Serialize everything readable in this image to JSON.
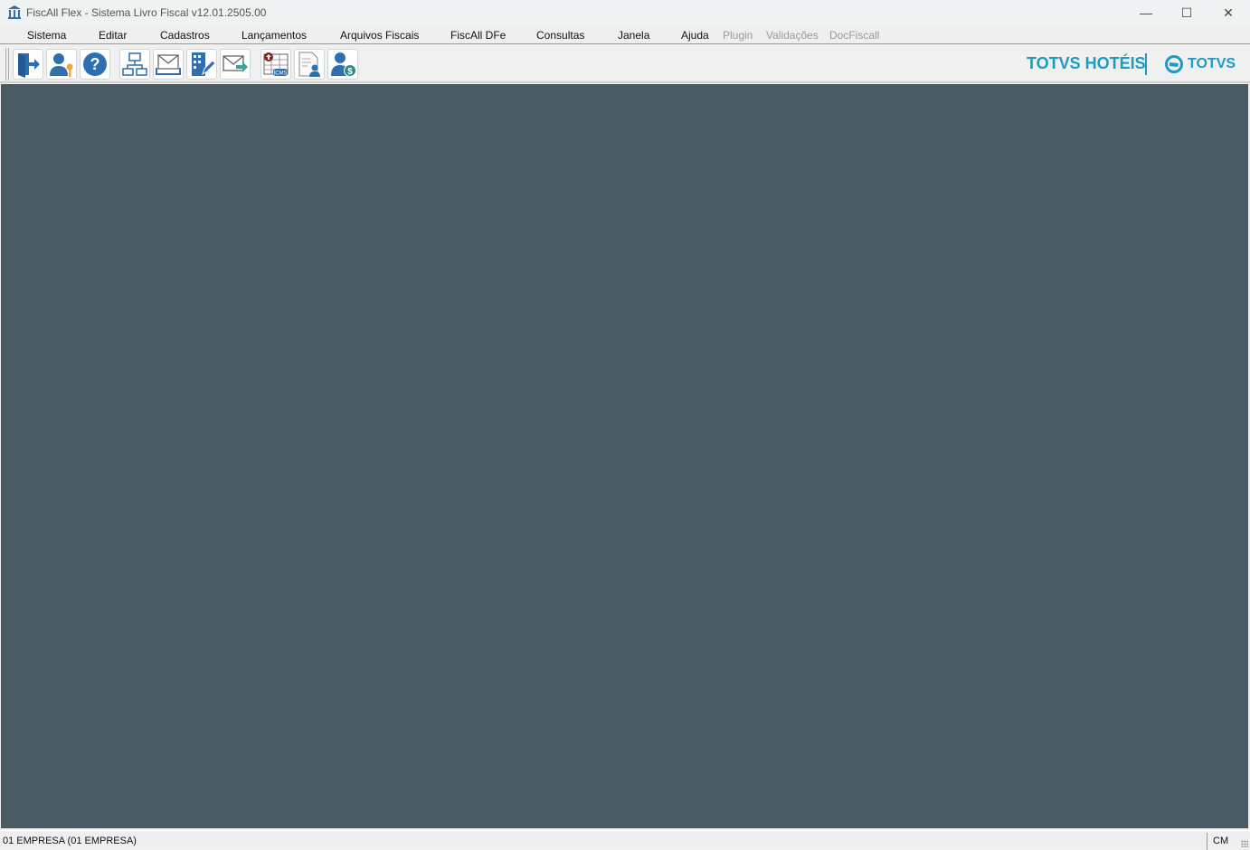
{
  "window": {
    "title": "FiscAll Flex - Sistema Livro Fiscal v12.01.2505.00",
    "minimize": "—",
    "maximize": "☐",
    "close": "✕"
  },
  "menu": [
    {
      "label": "Sistema",
      "enabled": true
    },
    {
      "label": "Editar",
      "enabled": true
    },
    {
      "label": "Cadastros",
      "enabled": true
    },
    {
      "label": "Lançamentos",
      "enabled": true
    },
    {
      "label": "Arquivos Fiscais",
      "enabled": true
    },
    {
      "label": "FiscAll DFe",
      "enabled": true
    },
    {
      "label": "Consultas",
      "enabled": true
    },
    {
      "label": "Janela",
      "enabled": true
    },
    {
      "label": "Ajuda",
      "enabled": true
    },
    {
      "label": "Plugin",
      "enabled": false
    },
    {
      "label": "Validações",
      "enabled": false
    },
    {
      "label": "DocFiscall",
      "enabled": false
    }
  ],
  "toolbar": {
    "buttons": [
      "exit-icon",
      "user-key-icon",
      "help-icon",
      "org-chart-icon",
      "mail-inbox-icon",
      "building-edit-icon",
      "mail-send-icon",
      "icms-table-icon",
      "document-user-icon",
      "user-money-icon"
    ],
    "icms_label": "ICMS",
    "brand_left": "TOTVS HOTÉIS",
    "brand_right": "TOTVS"
  },
  "colors": {
    "brand": "#1a9cc4",
    "icon_blue": "#2f6fb0",
    "workspace": "#4a5a63"
  },
  "status": {
    "company": "01 EMPRESA (01 EMPRESA)",
    "mode": "CM"
  }
}
